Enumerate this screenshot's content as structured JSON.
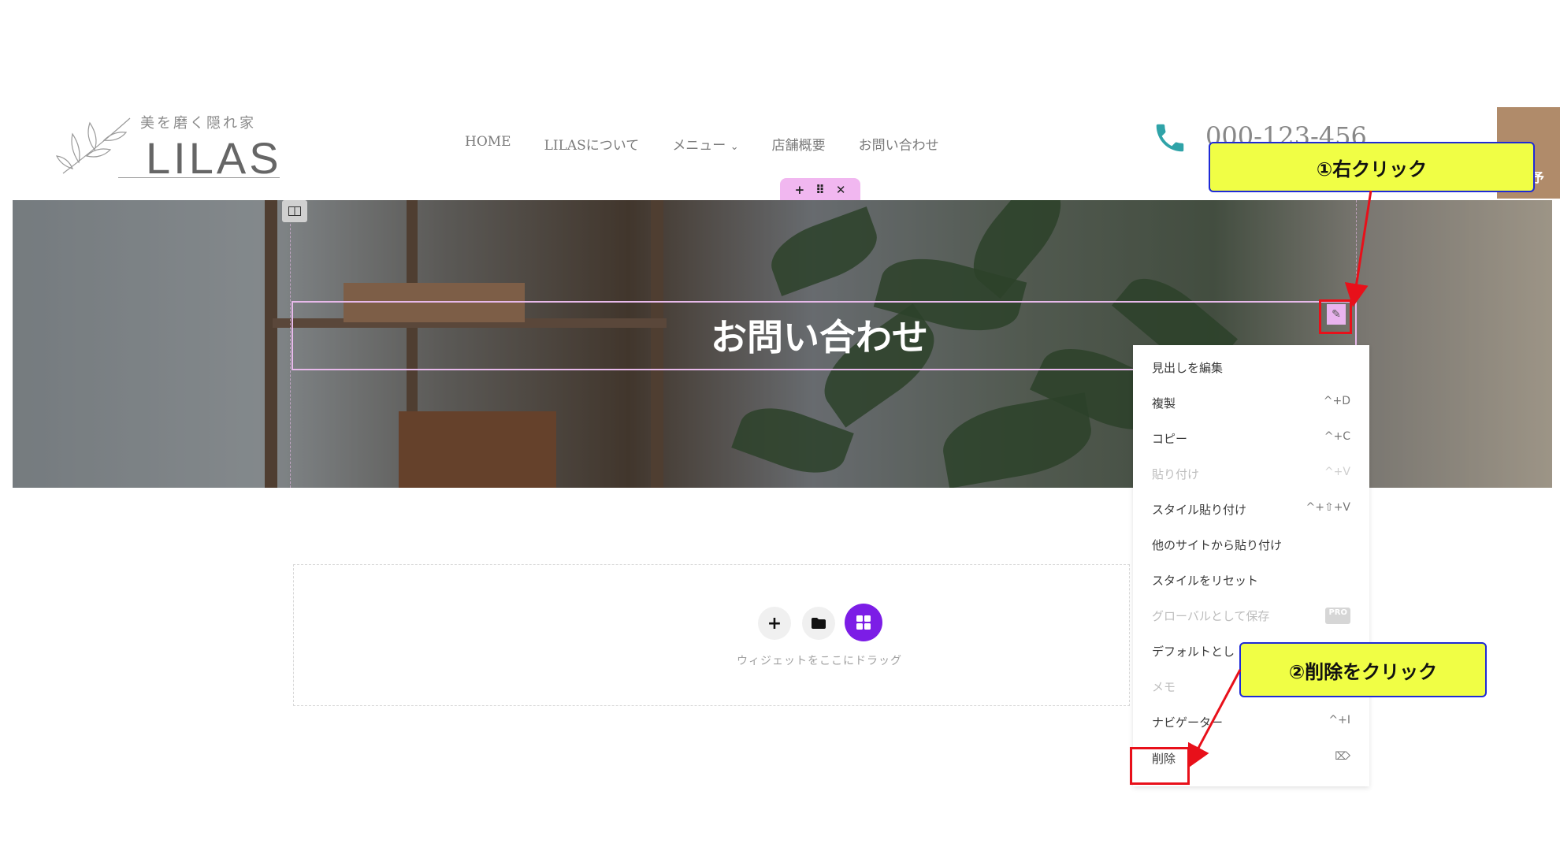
{
  "header": {
    "logo_tagline": "美を磨く隠れ家",
    "logo_name": "LILAS",
    "nav": [
      "HOME",
      "LILASについて",
      "メニュー",
      "店舗概要",
      "お問い合わせ"
    ],
    "phone": "000-123-456",
    "reserve_label": "予"
  },
  "hero": {
    "heading": "お問い合わせ"
  },
  "drop_zone": {
    "hint": "ウィジェットをここにドラッグ"
  },
  "context_menu": {
    "items": [
      {
        "label": "見出しを編集",
        "shortcut": "",
        "disabled": false
      },
      {
        "label": "複製",
        "shortcut": "^+D",
        "disabled": false
      },
      {
        "label": "コピー",
        "shortcut": "^+C",
        "disabled": false
      },
      {
        "label": "貼り付け",
        "shortcut": "^+V",
        "disabled": true
      },
      {
        "label": "スタイル貼り付け",
        "shortcut": "^+⇧+V",
        "disabled": false
      },
      {
        "label": "他のサイトから貼り付け",
        "shortcut": "",
        "disabled": false
      },
      {
        "label": "スタイルをリセット",
        "shortcut": "",
        "disabled": false
      },
      {
        "label": "グローバルとして保存",
        "shortcut": "PRO",
        "disabled": true
      },
      {
        "label": "デフォルトとし",
        "shortcut": "",
        "disabled": false
      },
      {
        "label": "メモ",
        "shortcut": "",
        "disabled": true
      },
      {
        "label": "ナビゲーター",
        "shortcut": "^+I",
        "disabled": false
      },
      {
        "label": "削除",
        "shortcut": "⌦",
        "disabled": false
      }
    ]
  },
  "annotations": {
    "step1": "①右クリック",
    "step2": "②削除をクリック",
    "highlight_color": "#e8101a",
    "callout_bg": "#f0fe45",
    "callout_border": "#1e2ad6"
  },
  "colors": {
    "accent_purple": "#7c1de6",
    "handle_pink": "#f1b7f0",
    "phone_teal": "#2fa3a8"
  },
  "icons": [
    "leaf-logo-icon",
    "chevron-down-icon",
    "phone-icon",
    "plus-icon",
    "drag-handle-icon",
    "close-icon",
    "column-icon",
    "pencil-icon",
    "folder-icon",
    "grid-icon"
  ]
}
